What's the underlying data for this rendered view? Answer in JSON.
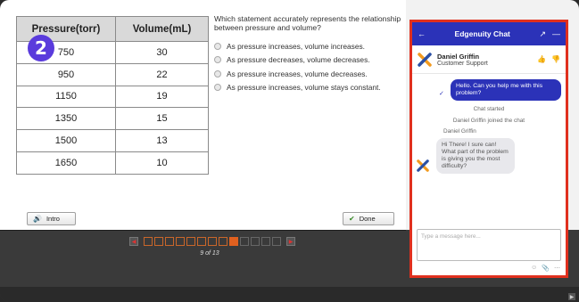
{
  "table": {
    "headers": [
      "Pressure(torr)",
      "Volume(mL)"
    ],
    "rows": [
      [
        "750",
        "30"
      ],
      [
        "950",
        "22"
      ],
      [
        "1150",
        "19"
      ],
      [
        "1350",
        "15"
      ],
      [
        "1500",
        "13"
      ],
      [
        "1650",
        "10"
      ]
    ]
  },
  "step_badge": "2",
  "question": {
    "text": "Which statement accurately represents the relationship between pressure and volume?",
    "options": [
      "As pressure increases, volume increases.",
      "As pressure decreases, volume decreases.",
      "As pressure increases, volume decreases.",
      "As pressure increases, volume stays constant."
    ]
  },
  "buttons": {
    "intro": "Intro",
    "done": "Done"
  },
  "pager": {
    "total_boxes": 13,
    "current": 9,
    "label": "9 of 13"
  },
  "chat": {
    "title": "Edgenuity Chat",
    "agent_name": "Daniel Griffin",
    "agent_role": "Customer Support",
    "user_message": "Hello. Can you help me with this problem?",
    "system_started": "Chat started",
    "system_joined": "Daniel Griffin joined the chat",
    "sender_label": "Daniel Griffin",
    "agent_message": "Hi There! I sure can! What part of the problem is giving you the most difficulty?",
    "compose_placeholder": "Type a message here..."
  },
  "colors": {
    "chat_header": "#2b32b8",
    "chat_border": "#e0301e",
    "badge": "#5a3bdc",
    "pager_active": "#e0601f"
  }
}
